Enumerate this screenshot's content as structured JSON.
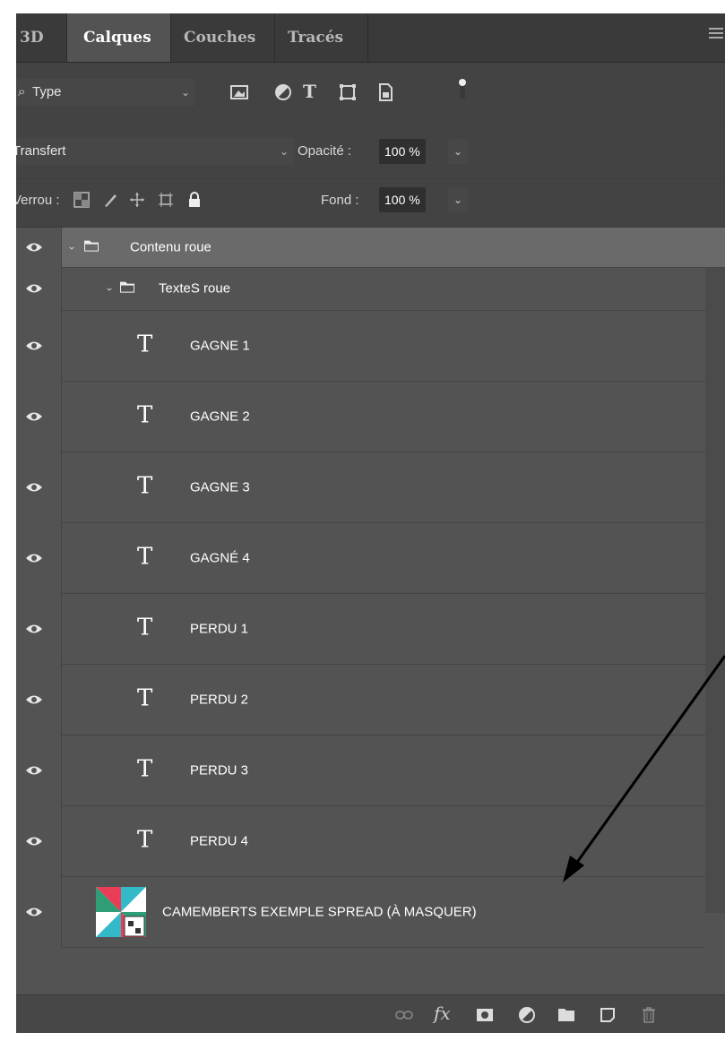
{
  "tabs": [
    {
      "label": "3D",
      "active": false
    },
    {
      "label": "Calques",
      "active": true
    },
    {
      "label": "Couches",
      "active": false
    },
    {
      "label": "Tracés",
      "active": false
    }
  ],
  "filter": {
    "kind_label": "Type"
  },
  "blend": {
    "mode": "Transfert",
    "opacity_label": "Opacité :",
    "opacity_value": "100 %"
  },
  "lock": {
    "label": "Verrou :",
    "fill_label": "Fond :",
    "fill_value": "100 %"
  },
  "layers": [
    {
      "name": "Contenu roue",
      "kind": "group",
      "selected": true
    },
    {
      "name": "TexteS roue",
      "kind": "group",
      "selected": false
    },
    {
      "name": "GAGNE 1",
      "kind": "text"
    },
    {
      "name": "GAGNE 2",
      "kind": "text"
    },
    {
      "name": "GAGNE 3",
      "kind": "text"
    },
    {
      "name": "GAGNÉ 4",
      "kind": "text"
    },
    {
      "name": "PERDU 1",
      "kind": "text"
    },
    {
      "name": "PERDU 2",
      "kind": "text"
    },
    {
      "name": "PERDU 3",
      "kind": "text"
    },
    {
      "name": "PERDU 4",
      "kind": "text"
    },
    {
      "name": "CAMEMBERTS EXEMPLE SPREAD (À MASQUER)",
      "kind": "smart-object"
    }
  ],
  "text_glyph": "T",
  "bottom_fx": "fx",
  "colors": {
    "panel": "#535353",
    "tabbar": "#3a3a3a",
    "selected_row": "#6a6a6a"
  }
}
